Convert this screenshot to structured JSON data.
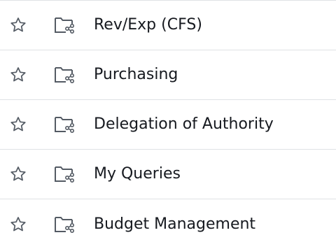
{
  "folders": {
    "items": [
      {
        "label": "Rev/Exp (CFS)",
        "star_icon": "star-outline-icon",
        "folder_icon": "shared-folder-icon"
      },
      {
        "label": "Purchasing",
        "star_icon": "star-outline-icon",
        "folder_icon": "shared-folder-icon"
      },
      {
        "label": "Delegation of Authority",
        "star_icon": "star-outline-icon",
        "folder_icon": "shared-folder-icon"
      },
      {
        "label": "My Queries",
        "star_icon": "star-outline-icon",
        "folder_icon": "shared-folder-icon"
      },
      {
        "label": "Budget Management",
        "star_icon": "star-outline-icon",
        "folder_icon": "shared-folder-icon"
      }
    ]
  },
  "colors": {
    "text": "#16191f",
    "icon": "#545b64",
    "divider": "#dfe2e5",
    "background": "#ffffff"
  }
}
